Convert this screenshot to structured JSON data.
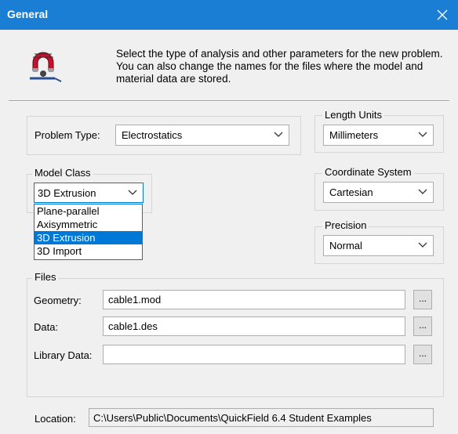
{
  "window": {
    "title": "General",
    "close_glyph": "✕"
  },
  "header": {
    "icon": "magnet-coil-icon",
    "description": "Select the type of analysis and other parameters for the new problem. You can also change the names for the files where the model and material data are stored."
  },
  "problem_type": {
    "label": "Problem Type:",
    "value": "Electrostatics"
  },
  "length_units": {
    "legend": "Length Units",
    "value": "Millimeters"
  },
  "model_class": {
    "legend": "Model Class",
    "value": "3D Extrusion",
    "options": [
      "Plane-parallel",
      "Axisymmetric",
      "3D Extrusion",
      "3D Import"
    ],
    "selected": "3D Extrusion"
  },
  "coordinate_system": {
    "legend": "Coordinate System",
    "value": "Cartesian"
  },
  "precision": {
    "legend": "Precision",
    "value": "Normal"
  },
  "files": {
    "legend": "Files",
    "geometry": {
      "label": "Geometry:",
      "value": "cable1.mod",
      "browse": "..."
    },
    "data": {
      "label": "Data:",
      "value": "cable1.des",
      "browse": "..."
    },
    "library_data": {
      "label": "Library Data:",
      "value": "",
      "browse": "..."
    }
  },
  "location": {
    "label": "Location:",
    "value": "C:\\Users\\Public\\Documents\\QuickField 6.4 Student Examples"
  },
  "colors": {
    "titlebar": "#1a7fd4",
    "highlight": "#0078d7"
  }
}
